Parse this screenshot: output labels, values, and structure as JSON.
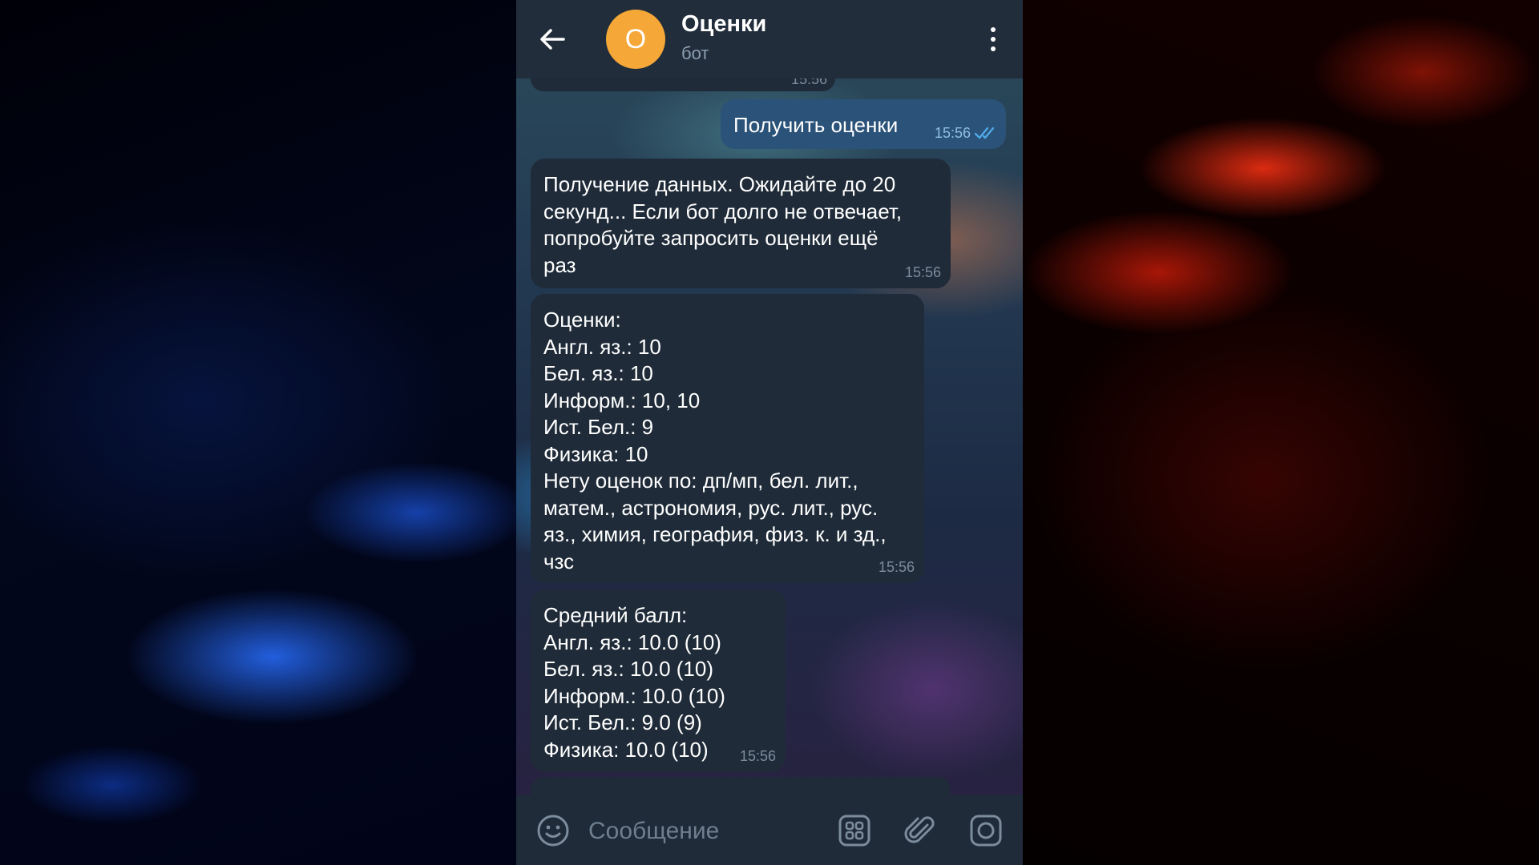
{
  "header": {
    "avatar_letter": "О",
    "avatar_color": "#f5a737",
    "title": "Оценки",
    "subtitle": "бот"
  },
  "messages": [
    {
      "direction": "out",
      "text": "Получить оценки",
      "time": "15:56",
      "status": "read"
    },
    {
      "direction": "in",
      "text": "Получение данных. Ожидайте до 20\nсекунд... Если бот долго не отвечает,\nпопробуйте запросить оценки ещё\nраз",
      "time": "15:56"
    },
    {
      "direction": "in",
      "text": "Оценки:\nАнгл. яз.: 10\nБел. яз.: 10\nИнформ.: 10, 10\nИст. Бел.: 9\nФизика: 10\nНету оценок по: дп/мп, бел. лит.,\nматем., астрономия, рус. лит., рус.\nяз., химия, география, физ. к. и зд.,\nчзс",
      "time": "15:56"
    },
    {
      "direction": "in",
      "text": "Средний балл:\nАнгл. яз.: 10.0 (10)\nБел. яз.: 10.0 (10)\nИнформ.: 10.0 (10)\nИст. Бел.: 9.0 (9)\nФизика: 10.0 (10)",
      "time": "15:56"
    }
  ],
  "partial_top_time": "15:56",
  "input": {
    "placeholder": "Сообщение"
  },
  "icons": {
    "back": "arrow-left-icon",
    "menu": "more-vertical-icon",
    "emoji": "smile-icon",
    "commands": "bot-commands-icon",
    "attach": "paperclip-icon",
    "camera": "camera-icon"
  },
  "colors": {
    "header_bg": "#212d3b",
    "incoming_bubble": "#1f2b38",
    "outgoing_bubble": "#2b5278",
    "read_checks": "#4fa9e6"
  }
}
